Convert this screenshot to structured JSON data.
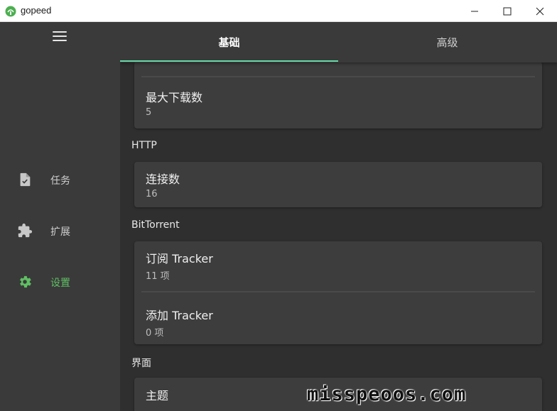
{
  "window": {
    "title": "gopeed",
    "accent": "#5fbf63"
  },
  "sidebar": {
    "menu_icon": "hamburger-icon",
    "items": [
      {
        "label": "任务",
        "icon": "task-file-icon",
        "active": false
      },
      {
        "label": "扩展",
        "icon": "puzzle-icon",
        "active": false
      },
      {
        "label": "设置",
        "icon": "gear-icon",
        "active": true
      }
    ]
  },
  "tabs": [
    {
      "label": "基础",
      "active": true
    },
    {
      "label": "高级",
      "active": false
    }
  ],
  "tab_indicator_color": "#66d9a8",
  "settings": {
    "max_downloads": {
      "title": "最大下载数",
      "value": "5"
    },
    "http_section": "HTTP",
    "connections": {
      "title": "连接数",
      "value": "16"
    },
    "bt_section": "BitTorrent",
    "subscribe_tracker": {
      "title": "订阅 Tracker",
      "value": "11 项"
    },
    "add_tracker": {
      "title": "添加 Tracker",
      "value": "0 项"
    },
    "ui_section": "界面",
    "theme": {
      "title": "主题"
    }
  },
  "watermark": "misspeoos.com"
}
